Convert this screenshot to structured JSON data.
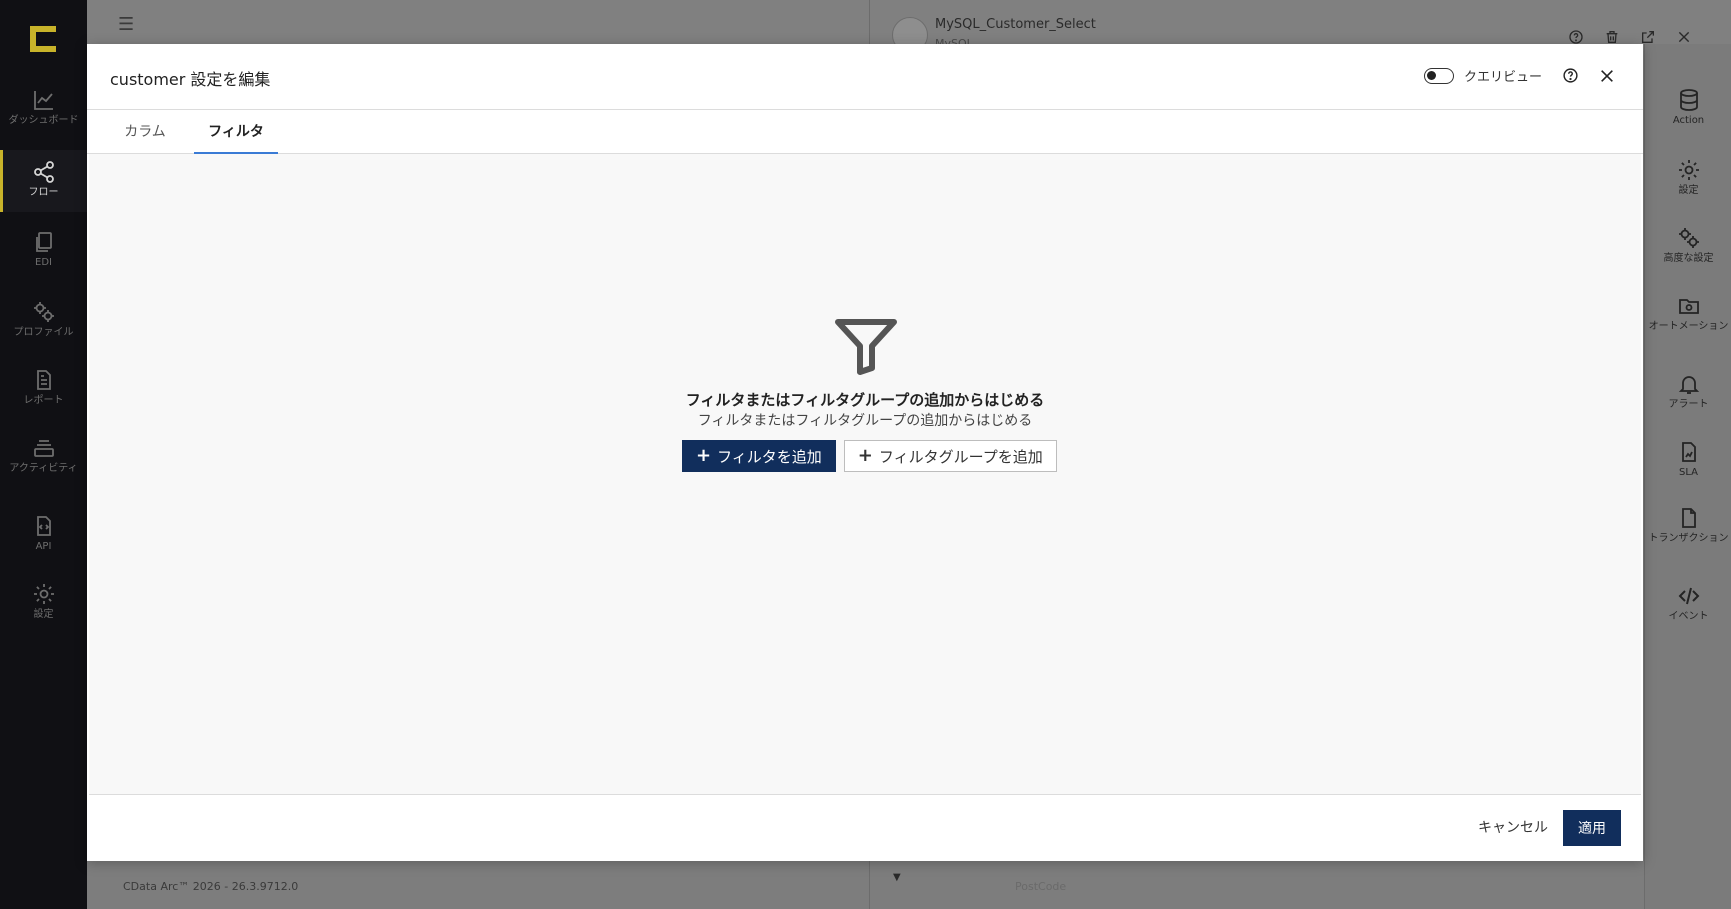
{
  "left_nav": {
    "items": [
      {
        "label": "ダッシュボード",
        "icon": "chart-line-icon"
      },
      {
        "label": "フロー",
        "icon": "share-nodes-icon"
      },
      {
        "label": "EDI",
        "icon": "documents-icon"
      },
      {
        "label": "プロファイル",
        "icon": "gears-icon"
      },
      {
        "label": "レポート",
        "icon": "report-icon"
      },
      {
        "label": "アクティビティ",
        "icon": "stack-icon"
      },
      {
        "label": "API",
        "icon": "api-file-icon"
      },
      {
        "label": "設定",
        "icon": "gear-icon"
      }
    ]
  },
  "background": {
    "connector_title": "MySQL_Customer_Select",
    "connector_sub": "MySQL",
    "footer_version": "CData Arc™ 2026 - 26.3.9712.0",
    "bottom_faded": "PostCode"
  },
  "right_rail": {
    "items": [
      {
        "label": "Action",
        "icon": "database-icon"
      },
      {
        "label": "設定",
        "icon": "gear-icon"
      },
      {
        "label": "高度な設定",
        "icon": "gears-icon"
      },
      {
        "label": "オートメーション",
        "icon": "folder-gear-icon"
      },
      {
        "label": "アラート",
        "icon": "bell-icon"
      },
      {
        "label": "SLA",
        "icon": "sla-doc-icon"
      },
      {
        "label": "トランザクション",
        "icon": "file-icon"
      },
      {
        "label": "イベント",
        "icon": "code-icon"
      }
    ]
  },
  "modal": {
    "title": "customer 設定を編集",
    "query_view_label": "クエリビュー",
    "tabs": [
      {
        "label": "カラム"
      },
      {
        "label": "フィルタ"
      }
    ],
    "empty_title": "フィルタまたはフィルタグループの追加からはじめる",
    "empty_subtitle": "フィルタまたはフィルタグループの追加からはじめる",
    "add_filter_label": "フィルタを追加",
    "add_filter_group_label": "フィルタグループを追加",
    "cancel_label": "キャンセル",
    "apply_label": "適用"
  },
  "colors": {
    "primary": "#112e5c",
    "accent_logo": "#c8b32a",
    "tab_active": "#3a7bd5"
  }
}
